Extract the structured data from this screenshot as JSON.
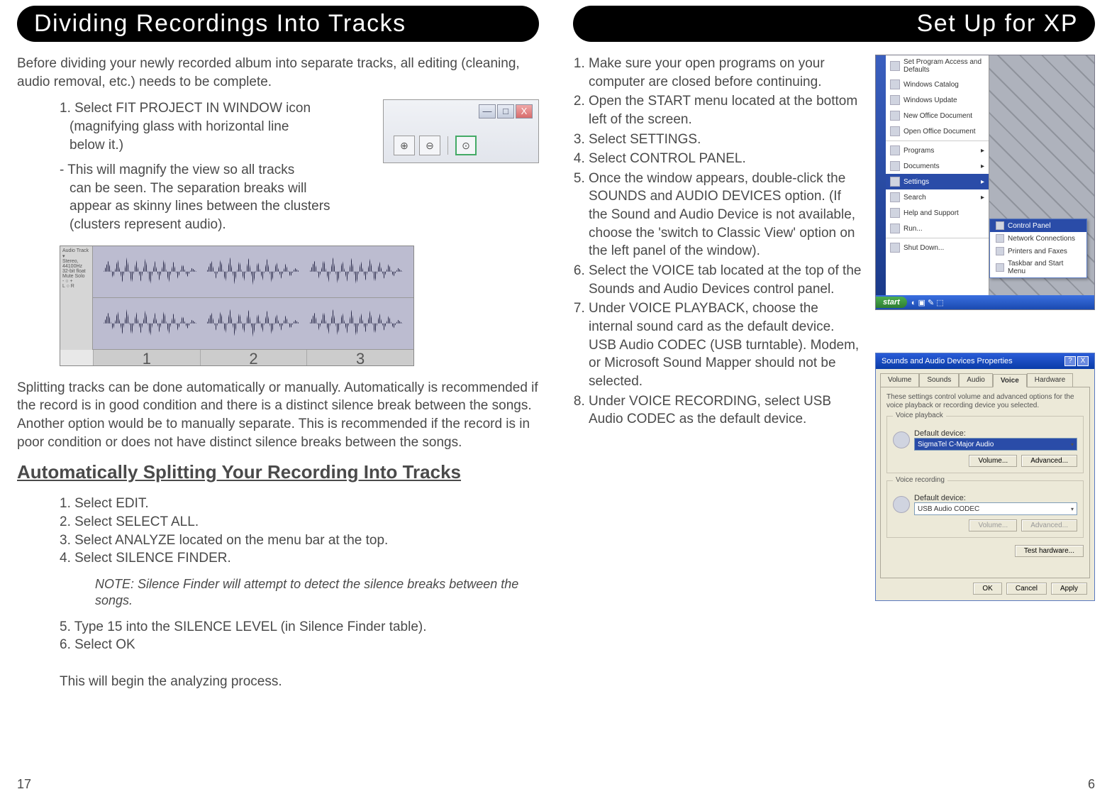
{
  "left": {
    "header": "Dividing Recordings Into Tracks",
    "intro": "Before dividing your newly recorded album into separate tracks, all editing (cleaning, audio removal, etc.) needs to be complete.",
    "step1": "1. Select FIT PROJECT IN WINDOW icon",
    "step1_l2": "(magnifying glass with horizontal line",
    "step1_l3": "below it.)",
    "step1_note": "- This will magnify the view so all tracks",
    "step1_note_l2": "can be seen. The separation breaks will",
    "step1_note_l3": "appear as skinny lines between the clusters",
    "step1_note_l4": "(clusters represent audio).",
    "wf_nums": [
      "1",
      "2",
      "3"
    ],
    "split_para": "Splitting tracks can be done automatically or manually. Automatically is recommended if the record is in good condition and there is a distinct silence break between the songs. Another option would be to manually separate. This is recommended if the record is in poor condition or does not have distinct silence breaks between the songs.",
    "auto_heading": "Automatically Splitting Your Recording Into Tracks",
    "auto_steps": {
      "s1": "1. Select EDIT.",
      "s2": "2. Select SELECT ALL.",
      "s3": "3. Select ANALYZE located on the menu bar at the top.",
      "s4": "4. Select SILENCE FINDER.",
      "note": "NOTE: Silence Finder will attempt to detect the silence breaks between the songs.",
      "s5": "5. Type 15 into the SILENCE LEVEL (in Silence Finder table).",
      "s6": "6. Select OK",
      "end": "This will begin the analyzing process."
    },
    "page_num": "17"
  },
  "right": {
    "header": "Set Up for XP",
    "steps": [
      "Make sure your open programs on your computer are closed before continuing.",
      "Open the START menu located at the bottom left of the screen.",
      "Select SETTINGS.",
      "Select CONTROL PANEL.",
      "Once the window appears, double-click the SOUNDS and AUDIO DEVICES option. (If the Sound and Audio Device is not available, choose the 'switch to Classic View' option on the left panel of the window).",
      "Select the VOICE tab located at the top of the Sounds and Audio Devices control panel.",
      "Under VOICE PLAYBACK, choose the internal sound card as the default device. USB Audio CODEC (USB turntable). Modem, or Microsoft Sound Mapper should not be selected.",
      "Under VOICE RECORDING, select USB Audio CODEC as the default device."
    ],
    "xp_menu": {
      "items": [
        "Set Program Access and Defaults",
        "Windows Catalog",
        "Windows Update",
        "New Office Document",
        "Open Office Document",
        "Programs",
        "Documents",
        "Settings",
        "Search",
        "Help and Support",
        "Run...",
        "Shut Down..."
      ],
      "submenu": [
        "Control Panel",
        "Network Connections",
        "Printers and Faxes",
        "Taskbar and Start Menu"
      ],
      "start": "start"
    },
    "sound_props": {
      "title": "Sounds and Audio Devices Properties",
      "tabs": [
        "Volume",
        "Sounds",
        "Audio",
        "Voice",
        "Hardware"
      ],
      "desc": "These settings control volume and advanced options for the voice playback or recording device you selected.",
      "playback_label": "Voice playback",
      "playback_dd_label": "Default device:",
      "playback_device": "SigmaTel C-Major Audio",
      "recording_label": "Voice recording",
      "recording_dd_label": "Default device:",
      "recording_device": "USB Audio CODEC",
      "btn_volume": "Volume...",
      "btn_advanced": "Advanced...",
      "btn_test": "Test hardware...",
      "btn_ok": "OK",
      "btn_cancel": "Cancel",
      "btn_apply": "Apply"
    },
    "page_num": "6"
  },
  "toolbar": {
    "min": "—",
    "max": "□",
    "close": "X",
    "zin": "⊕",
    "zout": "⊖",
    "fit": "⊙"
  }
}
